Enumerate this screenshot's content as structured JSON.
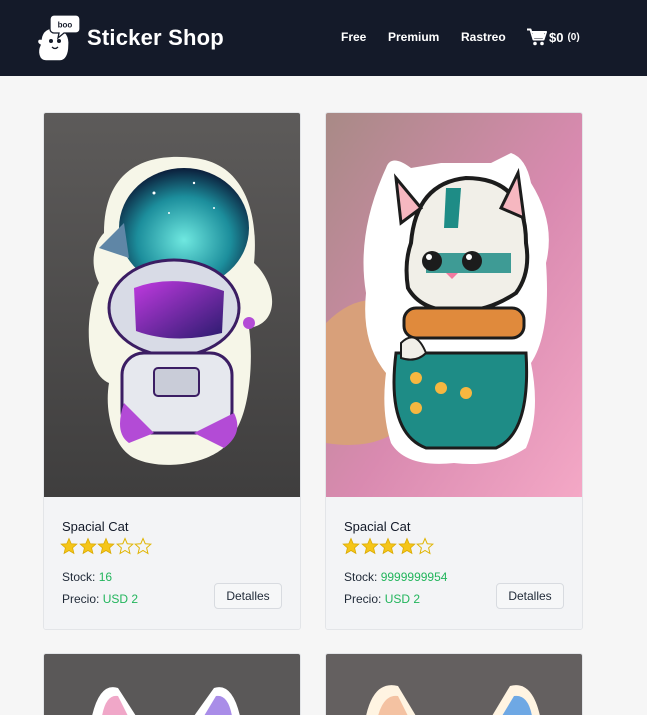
{
  "header": {
    "brand": "Sticker Shop",
    "logo_text": "boo",
    "nav": [
      {
        "label": "Free"
      },
      {
        "label": "Premium"
      },
      {
        "label": "Rastreo"
      }
    ],
    "cart": {
      "icon": "cart-icon",
      "total": "$0",
      "count": "(0)"
    }
  },
  "products": [
    {
      "title": "Spacial Cat",
      "rating": 3,
      "rating_max": 5,
      "stock_label": "Stock:",
      "stock": "16",
      "price_label": "Precio:",
      "price": "USD 2",
      "button": "Detalles",
      "image": "astronaut-sticker-image"
    },
    {
      "title": "Spacial Cat",
      "rating": 4,
      "rating_max": 5,
      "stock_label": "Stock:",
      "stock": "9999999954",
      "price_label": "Precio:",
      "price": "USD 2",
      "button": "Detalles",
      "image": "cat-sticker-image"
    },
    {
      "image": "cat-ears-sticker-image"
    },
    {
      "image": "cat-ears-sticker-image"
    }
  ],
  "colors": {
    "navbar": "#141a29",
    "accent_green": "#22b55c",
    "star": "#f5c518",
    "background": "#f6f6f6"
  }
}
